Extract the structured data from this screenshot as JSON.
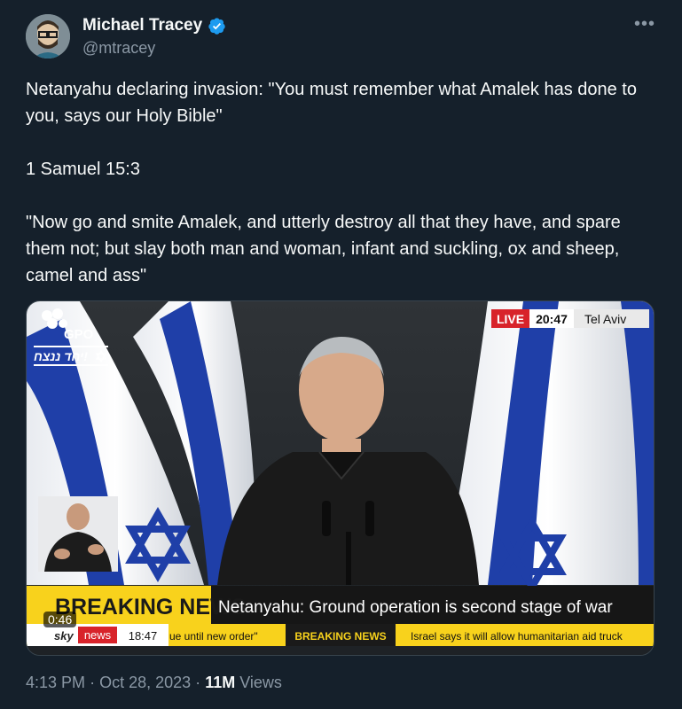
{
  "author": {
    "name": "Michael Tracey",
    "handle": "@mtracey"
  },
  "tweet": {
    "paragraphs": [
      "Netanyahu declaring invasion: \"You must remember what Amalek has done to you, says our Holy Bible\"",
      "1 Samuel 15:3",
      "\"Now go and smite Amalek, and utterly destroy all that they have, and spare them not; but slay both man and woman, infant and suckling, ox and sheep, camel and ass\""
    ]
  },
  "video": {
    "gpo_logo": "GPO",
    "hebrew_slogan": "יחד ננצח!",
    "live_label": "LIVE",
    "time": "20:47",
    "location": "Tel Aviv",
    "breaking_news": "BREAKING NEWS",
    "headline": "Netanyahu: Ground operation is second stage of war",
    "sky_brand": "sky",
    "news_label": "news",
    "ticker_time": "18:47",
    "ticker_text_1": "ue until new order\"",
    "ticker_breaking": "BREAKING NEWS",
    "ticker_text_2": "Israel says it will allow humanitarian aid truck",
    "duration": "0:46"
  },
  "meta": {
    "time": "4:13 PM",
    "date": "Oct 28, 2023",
    "separator": "·",
    "views_count": "11M",
    "views_label": "Views"
  },
  "colors": {
    "background": "#15202b",
    "verified": "#1d9bf0",
    "flag_blue": "#1f3fa8",
    "breaking_yellow": "#f8d21c",
    "live_red": "#d8232a"
  }
}
